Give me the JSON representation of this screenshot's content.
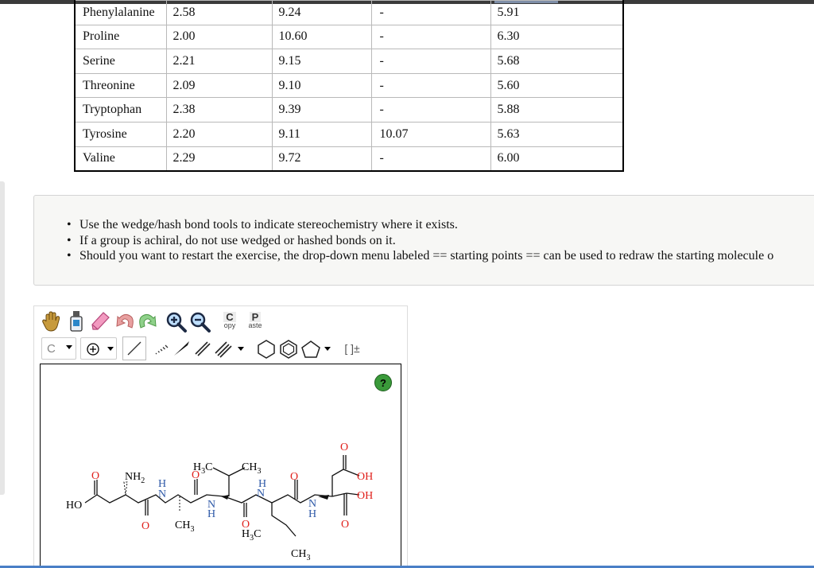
{
  "amino_acid_table": {
    "rows": [
      [
        "Phenylalanine",
        "2.58",
        "9.24",
        "-",
        "5.91"
      ],
      [
        "Proline",
        "2.00",
        "10.60",
        "-",
        "6.30"
      ],
      [
        "Serine",
        "2.21",
        "9.15",
        "-",
        "5.68"
      ],
      [
        "Threonine",
        "2.09",
        "9.10",
        "-",
        "5.60"
      ],
      [
        "Tryptophan",
        "2.38",
        "9.39",
        "-",
        "5.88"
      ],
      [
        "Tyrosine",
        "2.20",
        "9.11",
        "10.07",
        "5.63"
      ],
      [
        "Valine",
        "2.29",
        "9.72",
        "-",
        "6.00"
      ]
    ]
  },
  "instructions": [
    "Use the wedge/hash bond tools to indicate stereochemistry where it exists.",
    "If a group is achiral, do not use wedged or hashed bonds on it.",
    "Should you want to restart the exercise, the drop-down menu labeled == starting points == can be used to redraw the starting molecule o"
  ],
  "toolbar": {
    "copy_top": "C",
    "copy_bottom": "opy",
    "paste_top": "P",
    "paste_bottom": "aste",
    "element_selector": "C",
    "charge_label": "[ ]±",
    "help_label": "?",
    "icons": [
      "hand-icon",
      "bottle-icon",
      "eraser-icon",
      "undo-icon",
      "redo-icon",
      "zoom-in-icon",
      "zoom-out-icon",
      "charge-plus-icon",
      "single-bond-icon",
      "hash-bond-icon",
      "wedge-bond-icon",
      "double-bond-icon",
      "triple-bond-icon",
      "cyclohexane-icon",
      "benzene-icon",
      "cyclopentane-icon"
    ]
  },
  "molecule_labels": {
    "ho": "HO",
    "o_acid": "O",
    "nh2": "NH",
    "nh2_sub": "2",
    "n": "N",
    "h": "H",
    "o": "O",
    "h3c": "H",
    "h3c_sub": "3",
    "h3c_c": "C",
    "ch3": "CH",
    "ch3_sub": "3",
    "oh": "OH"
  },
  "colors": {
    "oxygen": "#e0201b",
    "nitrogen": "#2f5aa8",
    "carbon_label": "#111111",
    "help_green": "#3a9a3a",
    "accent_blue": "#4a7fc6"
  }
}
